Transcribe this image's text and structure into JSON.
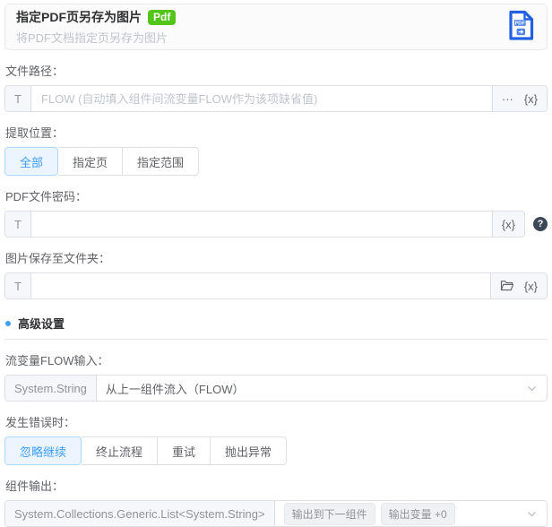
{
  "header": {
    "title": "指定PDF页另存为图片",
    "badge": "Pdf",
    "subtitle": "将PDF文档指定页另存为图片"
  },
  "fields": {
    "file_path": {
      "label": "文件路径：",
      "type_prefix": "T",
      "value": "",
      "placeholder": "FLOW (自动填入组件间流变量FLOW作为该项缺省值)",
      "browse_label": "···",
      "variable_label": "{x}"
    },
    "extract_position": {
      "label": "提取位置：",
      "options": [
        "全部",
        "指定页",
        "指定范围"
      ],
      "selected": "全部"
    },
    "pdf_password": {
      "label": "PDF文件密码：",
      "type_prefix": "T",
      "value": "",
      "variable_label": "{x}",
      "help": "?"
    },
    "save_folder": {
      "label": "图片保存至文件夹：",
      "type_prefix": "T",
      "value": "",
      "variable_label": "{x}"
    }
  },
  "advanced": {
    "section_title": "高级设置",
    "flow_input": {
      "label": "流变量FLOW输入：",
      "type_prefix": "System.String",
      "value": "从上一组件流入（FLOW）"
    },
    "on_error": {
      "label": "发生错误时：",
      "options": [
        "忽略继续",
        "终止流程",
        "重试",
        "抛出异常"
      ],
      "selected": "忽略继续"
    },
    "output": {
      "label": "组件输出：",
      "type_prefix": "System.Collections.Generic.List<System.String>",
      "tags": [
        "输出到下一组件",
        "输出变量 +0"
      ]
    }
  },
  "colors": {
    "accent_blue": "#409eff",
    "badge_green": "#52c41a",
    "icon_blue": "#2160e0",
    "selected_bg": "#ecf5ff"
  }
}
